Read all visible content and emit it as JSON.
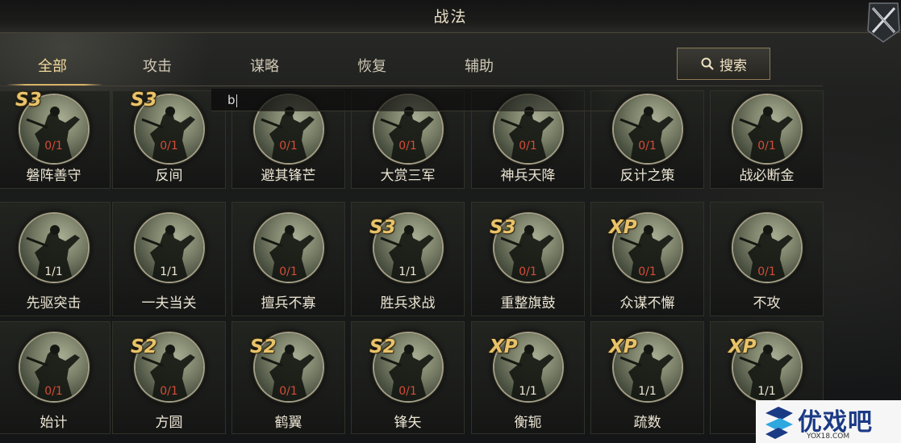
{
  "header": {
    "title": "战法"
  },
  "tabs": [
    "全部",
    "攻击",
    "谋略",
    "恢复",
    "辅助"
  ],
  "search": {
    "label": "搜索",
    "input_value": "b"
  },
  "cards": [
    {
      "name": "磐阵善守",
      "count": "0/1",
      "grade": "S3"
    },
    {
      "name": "反间",
      "count": "0/1",
      "grade": "S3"
    },
    {
      "name": "避其锋芒",
      "count": "0/1",
      "grade": ""
    },
    {
      "name": "大赏三军",
      "count": "0/1",
      "grade": ""
    },
    {
      "name": "神兵天降",
      "count": "0/1",
      "grade": ""
    },
    {
      "name": "反计之策",
      "count": "0/1",
      "grade": ""
    },
    {
      "name": "战必断金",
      "count": "0/1",
      "grade": ""
    },
    {
      "name": "先驱突击",
      "count": "1/1",
      "grade": ""
    },
    {
      "name": "一夫当关",
      "count": "1/1",
      "grade": ""
    },
    {
      "name": "擅兵不寡",
      "count": "0/1",
      "grade": ""
    },
    {
      "name": "胜兵求战",
      "count": "1/1",
      "grade": "S3"
    },
    {
      "name": "重整旗鼓",
      "count": "0/1",
      "grade": "S3"
    },
    {
      "name": "众谋不懈",
      "count": "0/1",
      "grade": "XP"
    },
    {
      "name": "不攻",
      "count": "0/1",
      "grade": ""
    },
    {
      "name": "始计",
      "count": "0/1",
      "grade": ""
    },
    {
      "name": "方圆",
      "count": "0/1",
      "grade": "S2"
    },
    {
      "name": "鹤翼",
      "count": "0/1",
      "grade": "S2"
    },
    {
      "name": "锋矢",
      "count": "0/1",
      "grade": "S2"
    },
    {
      "name": "衡轭",
      "count": "1/1",
      "grade": "XP"
    },
    {
      "name": "疏数",
      "count": "1/1",
      "grade": "XP"
    },
    {
      "name": "",
      "count": "1/1",
      "grade": "XP"
    }
  ],
  "watermark": {
    "text": "优戏吧",
    "url": "YOX18.COM"
  },
  "colors": {
    "accent": "#d7b26a",
    "count_zero": "#d54d3a",
    "count_full": "#efe7d6",
    "grade": "#e8c36a"
  }
}
